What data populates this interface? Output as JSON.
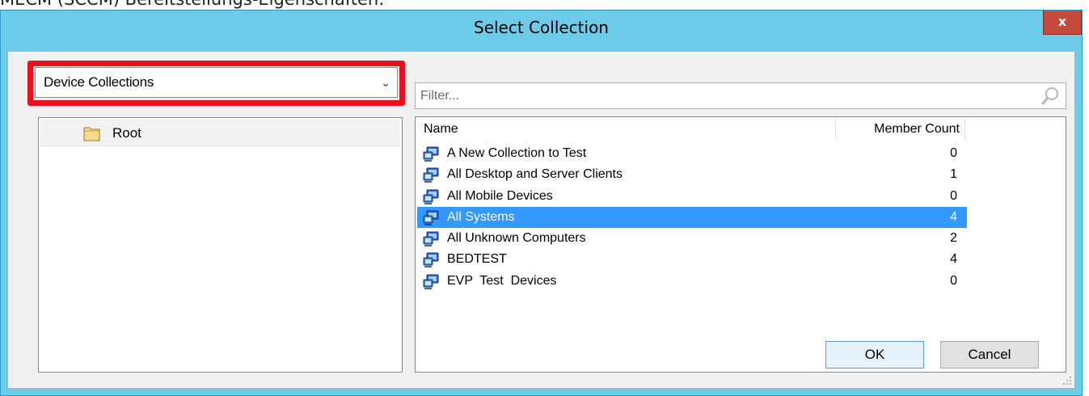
{
  "caption": "MECM (SCCM) Bereitstellungs-Eigenschaften:",
  "window": {
    "title": "Select Collection",
    "close_label": "x"
  },
  "collection_type": {
    "selected": "Device Collections"
  },
  "tree": {
    "items": [
      {
        "label": "Root"
      }
    ]
  },
  "filter": {
    "placeholder": "Filter...",
    "value": ""
  },
  "list": {
    "columns": {
      "name": "Name",
      "member_count": "Member Count"
    },
    "rows": [
      {
        "name": "A New Collection to Test",
        "count": "0",
        "selected": false
      },
      {
        "name": "All Desktop and Server Clients",
        "count": "1",
        "selected": false
      },
      {
        "name": "All Mobile Devices",
        "count": "0",
        "selected": false
      },
      {
        "name": "All Systems",
        "count": "4",
        "selected": true
      },
      {
        "name": "All Unknown Computers",
        "count": "2",
        "selected": false
      },
      {
        "name": "BEDTEST",
        "count": "4",
        "selected": false
      },
      {
        "name": "EVP  Test  Devices",
        "count": "0",
        "selected": false
      }
    ]
  },
  "buttons": {
    "ok": "OK",
    "cancel": "Cancel"
  },
  "colors": {
    "titlebar": "#6ccbe9",
    "selection": "#3399ff",
    "highlight": "#e8101d",
    "close": "#c44a3c"
  },
  "icons": {
    "tree_item": "folder-icon",
    "collection_row": "device-collection-icon",
    "filter": "search-icon",
    "dropdown": "chevron-down-icon"
  }
}
